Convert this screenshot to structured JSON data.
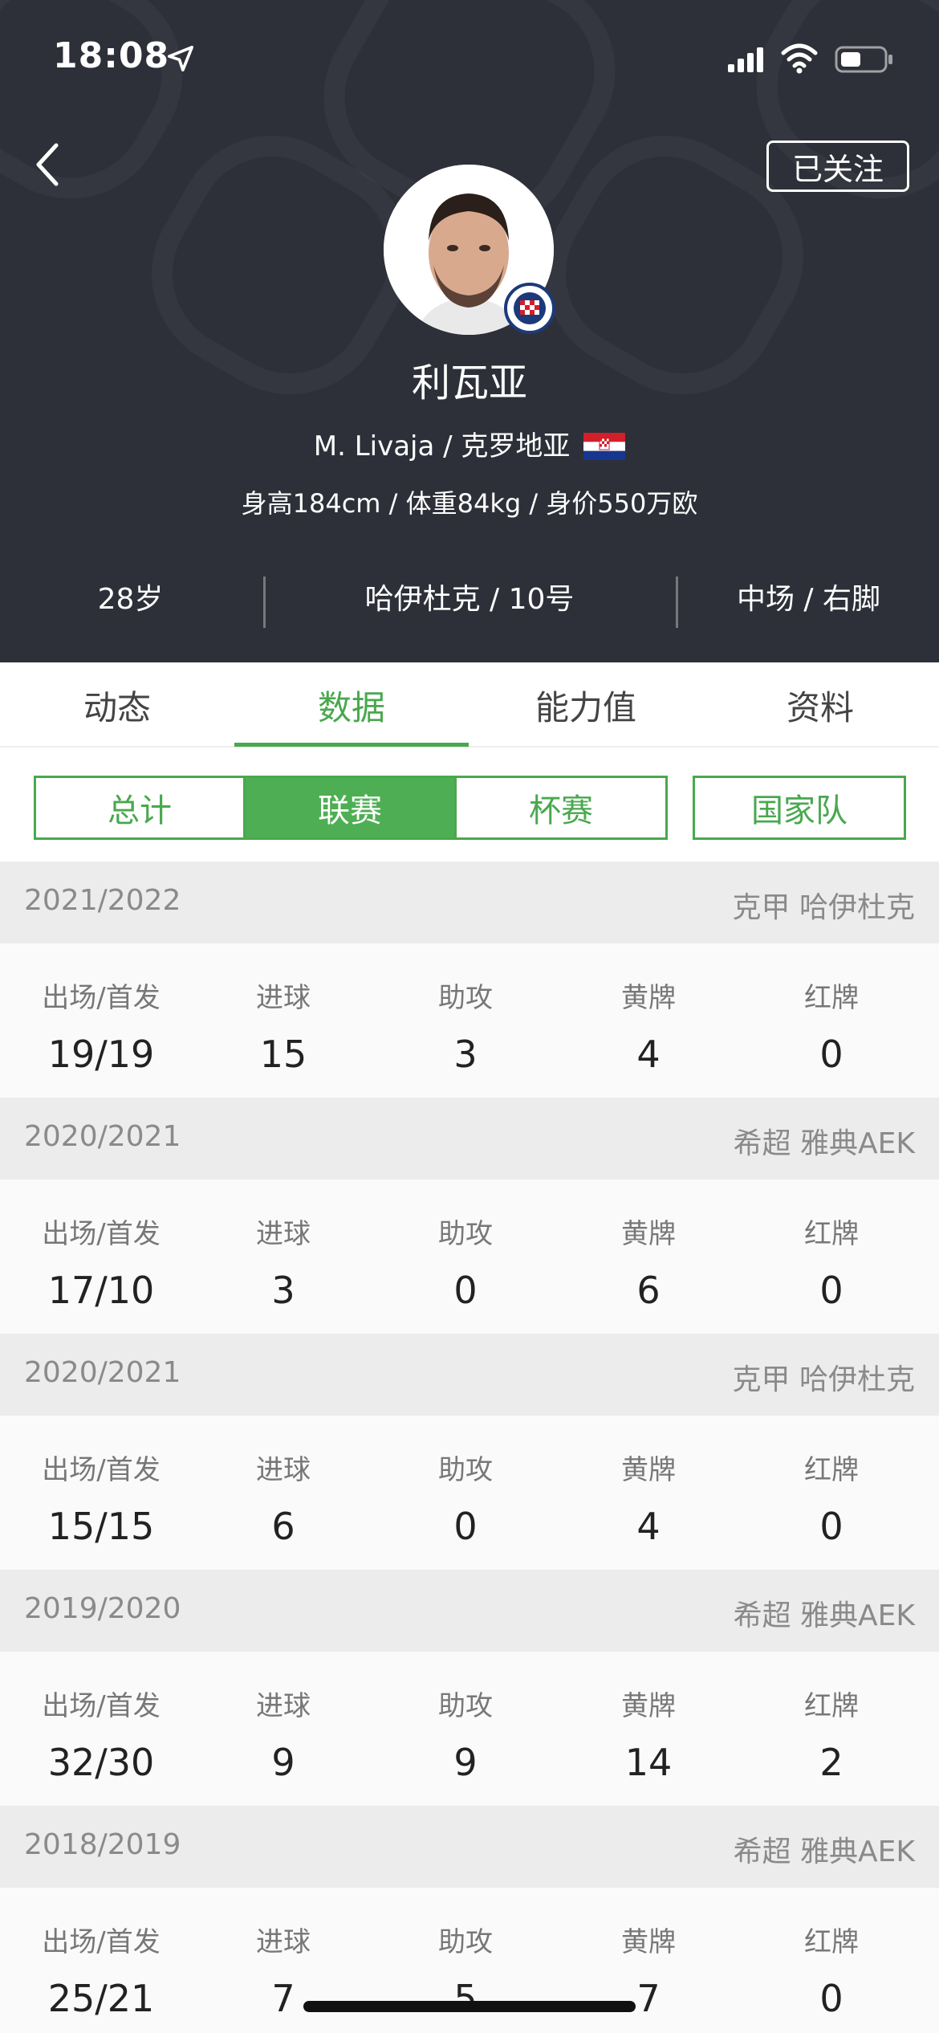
{
  "status_bar": {
    "time": "18:08"
  },
  "header": {
    "follow_label": "已关注",
    "name": "利瓦亚",
    "sub": "M. Livaja / 克罗地亚",
    "physical": "身高184cm / 体重84kg / 身价550万欧",
    "age": "28岁",
    "club_number": "哈伊杜克 / 10号",
    "position_foot": "中场 / 右脚"
  },
  "tabs": [
    "动态",
    "数据",
    "能力值",
    "资料"
  ],
  "filters": [
    "总计",
    "联赛",
    "杯赛",
    "国家队"
  ],
  "stat_labels": [
    "出场/首发",
    "进球",
    "助攻",
    "黄牌",
    "红牌"
  ],
  "seasons": [
    {
      "year": "2021/2022",
      "league": "克甲 哈伊杜克",
      "values": [
        "19/19",
        "15",
        "3",
        "4",
        "0"
      ]
    },
    {
      "year": "2020/2021",
      "league": "希超 雅典AEK",
      "values": [
        "17/10",
        "3",
        "0",
        "6",
        "0"
      ]
    },
    {
      "year": "2020/2021",
      "league": "克甲 哈伊杜克",
      "values": [
        "15/15",
        "6",
        "0",
        "4",
        "0"
      ]
    },
    {
      "year": "2019/2020",
      "league": "希超 雅典AEK",
      "values": [
        "32/30",
        "9",
        "9",
        "14",
        "2"
      ]
    },
    {
      "year": "2018/2019",
      "league": "希超 雅典AEK",
      "values": [
        "25/21",
        "7",
        "5",
        "7",
        "0"
      ]
    }
  ],
  "colors": {
    "header_bg": "#2d3038",
    "accent": "#4eae53"
  },
  "icons": [
    "location-arrow-icon",
    "cellular-signal-icon",
    "wifi-icon",
    "battery-icon",
    "back-chevron-icon",
    "croatia-flag-icon",
    "club-badge-icon"
  ]
}
